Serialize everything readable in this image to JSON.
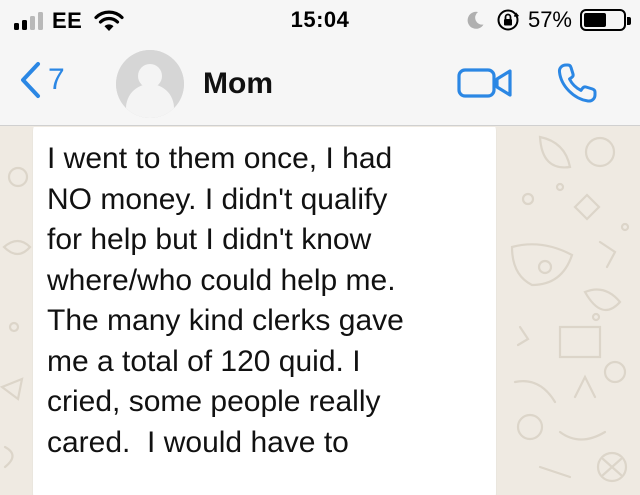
{
  "status_bar": {
    "carrier": "EE",
    "time": "15:04",
    "battery_percent": "57%",
    "battery_level": 0.57,
    "signal_bars": 2,
    "icons": [
      "signal-icon",
      "wifi-icon",
      "moon-icon",
      "orientation-lock-icon",
      "battery-icon"
    ]
  },
  "header": {
    "back_count": "7",
    "contact_name": "Mom",
    "icons": [
      "back-chevron-icon",
      "avatar-placeholder-icon",
      "video-call-icon",
      "phone-call-icon"
    ]
  },
  "message": {
    "lines": [
      "I went to them once, I had",
      "NO money. I didn't qualify",
      "for help but I didn't know",
      "where/who could help me.",
      "The many kind clerks gave",
      "me a total of 120 quid. I",
      "cried, some people really",
      "cared.  I would have to"
    ]
  },
  "colors": {
    "accent": "#2b87e4",
    "header_bg": "#f6f6f6",
    "chat_bg": "#efeae2",
    "bubble_bg": "#ffffff"
  }
}
